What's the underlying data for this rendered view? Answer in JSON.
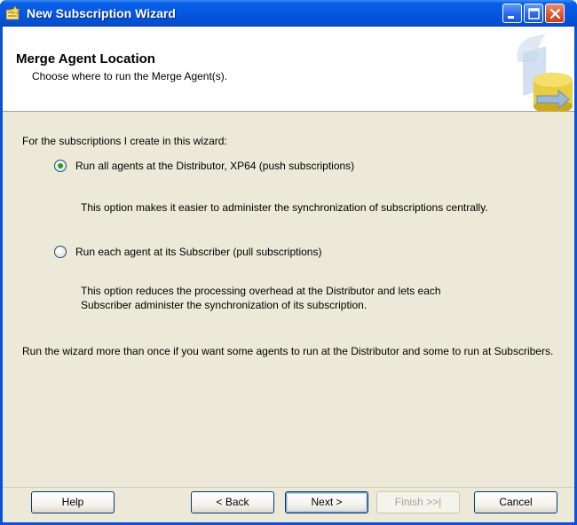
{
  "window": {
    "title": "New Subscription Wizard",
    "titlebar_color": "#0558e0"
  },
  "header": {
    "title": "Merge Agent Location",
    "subtitle": "Choose where to run the Merge Agent(s)."
  },
  "body": {
    "intro": "For the subscriptions I create in this wizard:",
    "options": [
      {
        "label": "Run all agents at the Distributor, XP64 (push subscriptions)",
        "description": "This option makes it easier to administer the synchronization of subscriptions centrally.",
        "selected": true
      },
      {
        "label": "Run each agent at its Subscriber (pull subscriptions)",
        "description": "This option reduces the processing overhead at the Distributor and lets each Subscriber administer the synchronization of its subscription.",
        "selected": false
      }
    ],
    "note": "Run the wizard more than once if you want some agents to run at the Distributor and some to run at Subscribers."
  },
  "footer": {
    "help": "Help",
    "back": "< Back",
    "next": "Next >",
    "finish": "Finish >>|",
    "cancel": "Cancel"
  },
  "icons": {
    "title": "wizard-app-icon",
    "header_art": "database-arrow-icon"
  }
}
